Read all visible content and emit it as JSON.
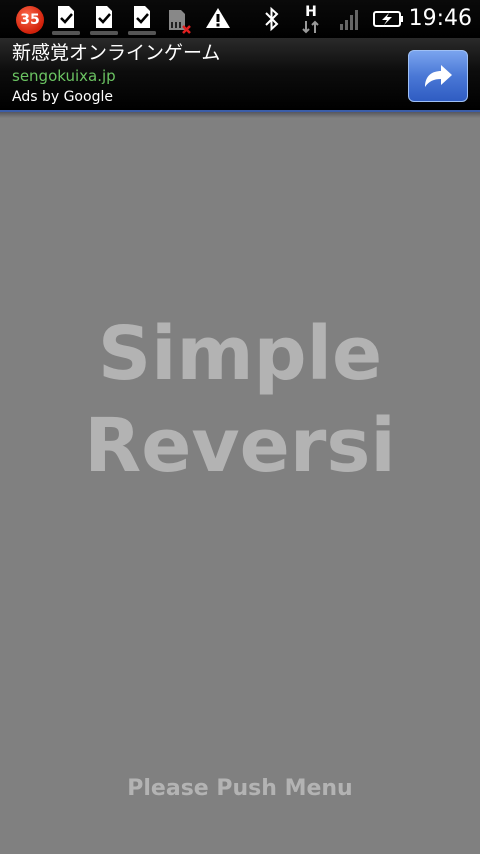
{
  "status_bar": {
    "notification_count": "35",
    "time": "19:46",
    "network_type": "H",
    "icons": [
      "notification-badge",
      "download-done-icon",
      "download-done-icon",
      "download-done-icon",
      "sd-card-error-icon",
      "warning-icon",
      "bluetooth-icon",
      "network-h-icon",
      "signal-icon",
      "battery-charging-icon"
    ]
  },
  "ad": {
    "title": "新感覚オンラインゲーム",
    "url": "sengokuixa.jp",
    "attribution": "Ads by Google",
    "button_icon": "share-arrow-icon",
    "accent_color": "#4a78d6",
    "url_color": "#6bc462"
  },
  "main": {
    "title_line1": "Simple",
    "title_line2": "Reversi",
    "hint": "Please Push Menu",
    "background_color": "#808080",
    "text_color": "#b3b3b3"
  }
}
